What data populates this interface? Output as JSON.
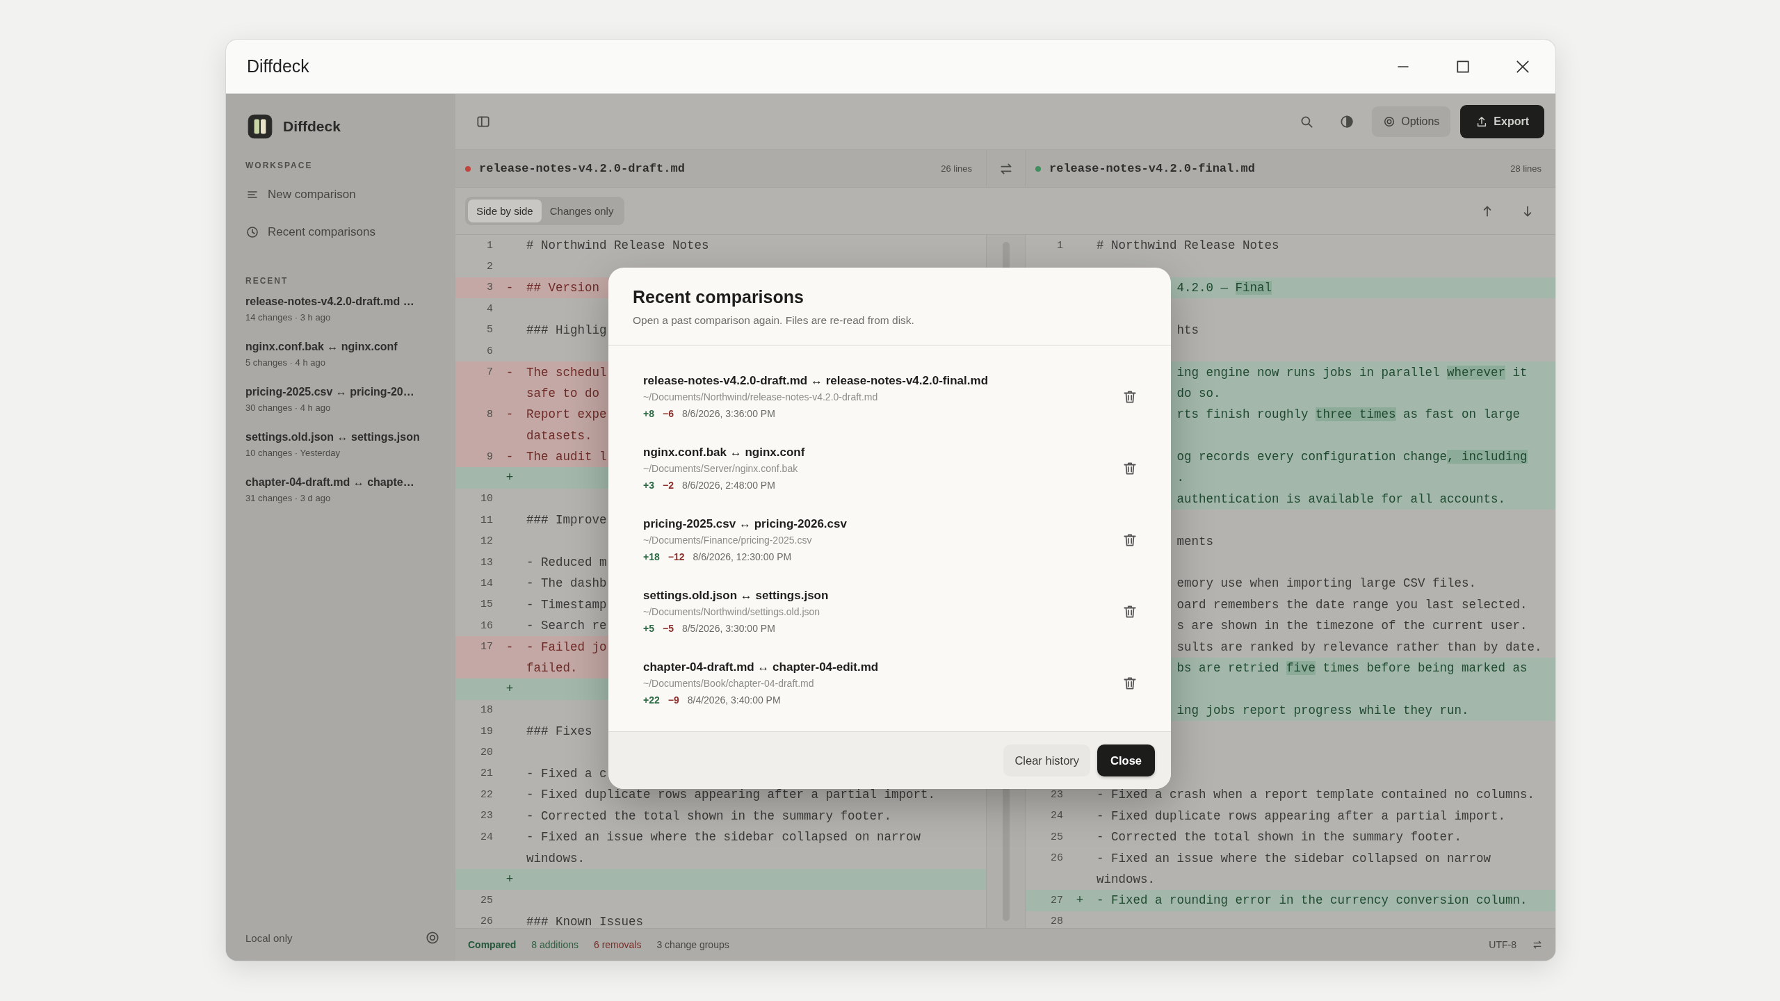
{
  "window": {
    "title": "Diffdeck"
  },
  "sidebar": {
    "brand": "Diffdeck",
    "workspace": {
      "heading": "WORKSPACE",
      "items": [
        {
          "kind": "new",
          "label": "New comparison"
        },
        {
          "kind": "history",
          "label": "Recent comparisons"
        }
      ]
    },
    "recent": {
      "heading": "RECENT",
      "items": [
        {
          "title": "release-notes-v4.2.0-draft.md …",
          "meta": "14 changes · 3 h ago"
        },
        {
          "title": "nginx.conf.bak ↔ nginx.conf",
          "meta": "5 changes · 4 h ago"
        },
        {
          "title": "pricing-2025.csv ↔ pricing-20…",
          "meta": "30 changes · 4 h ago"
        },
        {
          "title": "settings.old.json ↔ settings.json",
          "meta": "10 changes · Yesterday"
        },
        {
          "title": "chapter-04-draft.md ↔ chapte…",
          "meta": "31 changes · 3 d ago"
        }
      ]
    },
    "footer": "Local only"
  },
  "toolbar": {
    "options": "Options",
    "export": "Export"
  },
  "files": [
    {
      "name": "release-notes-v4.2.0-draft.md",
      "lines": "26 lines",
      "color": "#c0453c"
    },
    {
      "name": "release-notes-v4.2.0-final.md",
      "lines": "28 lines",
      "color": "#3f8f5f"
    }
  ],
  "view_modes": [
    {
      "label": "Side by side",
      "selected": true
    },
    {
      "label": "Changes only",
      "selected": false
    }
  ],
  "panes": [
    {
      "rows": [
        {
          "kind": "context",
          "num": "1",
          "text": "# Northwind Release Notes"
        },
        {
          "kind": "context",
          "num": "2"
        },
        {
          "kind": "removed",
          "num": "3",
          "sign": "-",
          "text": "## Version"
        },
        {
          "kind": "context",
          "num": "4"
        },
        {
          "kind": "context",
          "num": "5",
          "text": "### Highlig"
        },
        {
          "kind": "context",
          "num": "6"
        },
        {
          "kind": "removed",
          "num": "7",
          "sign": "-",
          "text": "The schedul"
        },
        {
          "kind": "removed",
          "text": "safe to do"
        },
        {
          "kind": "removed",
          "num": "8",
          "sign": "-",
          "text": "Report expe"
        },
        {
          "kind": "removed",
          "text": "datasets."
        },
        {
          "kind": "removed",
          "num": "9",
          "sign": "-",
          "text": "The audit l"
        },
        {
          "kind": "added",
          "sign": "+"
        },
        {
          "kind": "context",
          "num": "10"
        },
        {
          "kind": "context",
          "num": "11",
          "text": "### Improve"
        },
        {
          "kind": "context",
          "num": "12"
        },
        {
          "kind": "context",
          "num": "13",
          "text": "- Reduced m"
        },
        {
          "kind": "context",
          "num": "14",
          "text": "- The dashb"
        },
        {
          "kind": "context",
          "num": "15",
          "text": "- Timestamp"
        },
        {
          "kind": "context",
          "num": "16",
          "text": "- Search re"
        },
        {
          "kind": "removed",
          "num": "17",
          "sign": "-",
          "text": "- Failed jo"
        },
        {
          "kind": "removed",
          "text": "failed."
        },
        {
          "kind": "added",
          "sign": "+"
        },
        {
          "kind": "context",
          "num": "18"
        },
        {
          "kind": "context",
          "num": "19",
          "text": "### Fixes"
        },
        {
          "kind": "context",
          "num": "20"
        },
        {
          "kind": "context",
          "num": "21",
          "text": "- Fixed a c"
        },
        {
          "kind": "context",
          "num": "22",
          "text": "- Fixed duplicate rows appearing after a partial import."
        },
        {
          "kind": "context",
          "num": "23",
          "text": "- Corrected the total shown in the summary footer."
        },
        {
          "kind": "context",
          "num": "24",
          "text": "- Fixed an issue where the sidebar collapsed on narrow"
        },
        {
          "kind": "context",
          "text": "windows."
        },
        {
          "kind": "added",
          "sign": "+"
        },
        {
          "kind": "context",
          "num": "25"
        },
        {
          "kind": "context",
          "num": "26",
          "text": "### Known Issues"
        }
      ]
    },
    {
      "rows": [
        {
          "kind": "context",
          "num": "1",
          "text": "# Northwind Release Notes"
        },
        {
          "kind": "context"
        },
        {
          "kind": "added",
          "cut_start": true,
          "parts": [
            {
              "text": "4.2.0 — "
            },
            {
              "text": "Final",
              "changed": true
            }
          ]
        },
        {
          "kind": "context"
        },
        {
          "kind": "context",
          "cut_start": true,
          "text": "hts"
        },
        {
          "kind": "context"
        },
        {
          "kind": "added",
          "cut_start": true,
          "parts": [
            {
              "text": "ing engine now runs jobs in parallel "
            },
            {
              "text": "wherever",
              "changed": true
            },
            {
              "text": " it"
            }
          ]
        },
        {
          "kind": "added",
          "cut_start": true,
          "text": "do so."
        },
        {
          "kind": "added",
          "cut_start": true,
          "parts": [
            {
              "text": "rts finish roughly "
            },
            {
              "text": "three times",
              "changed": true
            },
            {
              "text": " as fast on large"
            }
          ]
        },
        {
          "kind": "added"
        },
        {
          "kind": "added",
          "cut_start": true,
          "parts": [
            {
              "text": "og records every configuration change"
            },
            {
              "text": ", including",
              "changed": true
            }
          ]
        },
        {
          "kind": "added",
          "cut_start": true,
          "text": "."
        },
        {
          "kind": "added",
          "cut_start": true,
          "text": "authentication is available for all accounts."
        },
        {
          "kind": "context"
        },
        {
          "kind": "context",
          "cut_start": true,
          "text": "ments"
        },
        {
          "kind": "context"
        },
        {
          "kind": "context",
          "cut_start": true,
          "text": "emory use when importing large CSV files."
        },
        {
          "kind": "context",
          "cut_start": true,
          "text": "oard remembers the date range you last selected."
        },
        {
          "kind": "context",
          "cut_start": true,
          "text": "s are shown in the timezone of the current user."
        },
        {
          "kind": "context",
          "cut_start": true,
          "text": "sults are ranked by relevance rather than by date."
        },
        {
          "kind": "added",
          "cut_start": true,
          "parts": [
            {
              "text": "bs are retried "
            },
            {
              "text": "five",
              "changed": true
            },
            {
              "text": " times before being marked as"
            }
          ]
        },
        {
          "kind": "added"
        },
        {
          "kind": "added",
          "cut_start": true,
          "text": "ing jobs report progress while they run."
        },
        {
          "kind": "context"
        },
        {
          "kind": "context"
        },
        {
          "kind": "context"
        },
        {
          "kind": "context",
          "num": "23",
          "text": "- Fixed a crash when a report template contained no columns."
        },
        {
          "kind": "context",
          "num": "24",
          "text": "- Fixed duplicate rows appearing after a partial import."
        },
        {
          "kind": "context",
          "num": "25",
          "text": "- Corrected the total shown in the summary footer."
        },
        {
          "kind": "context",
          "num": "26",
          "text": "- Fixed an issue where the sidebar collapsed on narrow"
        },
        {
          "kind": "context",
          "text": "windows."
        },
        {
          "kind": "added",
          "num": "27",
          "sign": "+",
          "text": "- Fixed a rounding error in the currency conversion column."
        },
        {
          "kind": "context",
          "num": "28"
        }
      ]
    }
  ],
  "status_bar": {
    "state": "Compared",
    "additions": "8 additions",
    "removals": "6 removals",
    "groups": "3 change groups",
    "encoding": "UTF-8"
  },
  "dialog": {
    "title": "Recent comparisons",
    "subtitle": "Open a past comparison again. Files are re-read from disk.",
    "items": [
      {
        "title": "release-notes-v4.2.0-draft.md ↔ release-notes-v4.2.0-final.md",
        "path": "~/Documents/Northwind/release-notes-v4.2.0-draft.md",
        "added": "+8",
        "removed": "−6",
        "time": "8/6/2026, 3:36:00 PM"
      },
      {
        "title": "nginx.conf.bak ↔ nginx.conf",
        "path": "~/Documents/Server/nginx.conf.bak",
        "added": "+3",
        "removed": "−2",
        "time": "8/6/2026, 2:48:00 PM"
      },
      {
        "title": "pricing-2025.csv ↔ pricing-2026.csv",
        "path": "~/Documents/Finance/pricing-2025.csv",
        "added": "+18",
        "removed": "−12",
        "time": "8/6/2026, 12:30:00 PM"
      },
      {
        "title": "settings.old.json ↔ settings.json",
        "path": "~/Documents/Northwind/settings.old.json",
        "added": "+5",
        "removed": "−5",
        "time": "8/5/2026, 3:30:00 PM"
      },
      {
        "title": "chapter-04-draft.md ↔ chapter-04-edit.md",
        "path": "~/Documents/Book/chapter-04-draft.md",
        "added": "+22",
        "removed": "−9",
        "time": "8/4/2026, 3:40:00 PM"
      }
    ],
    "buttons": [
      {
        "kind": "secondary",
        "label": "Clear history"
      },
      {
        "kind": "primary",
        "label": "Close"
      }
    ]
  }
}
